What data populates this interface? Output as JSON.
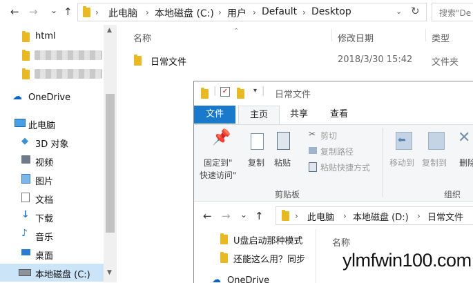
{
  "outer": {
    "nav": {
      "back": "←",
      "forward": "→",
      "recent": "⌄",
      "up": "↑"
    },
    "breadcrumb": [
      "此电脑",
      "本地磁盘 (C:)",
      "用户",
      "Default",
      "Desktop"
    ],
    "search_placeholder": "搜索\"De",
    "columns": {
      "name": "名称",
      "date": "修改日期",
      "type": "类型"
    },
    "file": {
      "name": "日常文件",
      "date": "2018/3/30 15:42",
      "type": "文件夹"
    },
    "sidebar": {
      "html": "html",
      "onedrive": "OneDrive",
      "thispc": "此电脑",
      "objects": "3D 对象",
      "video": "视频",
      "pictures": "图片",
      "docs": "文档",
      "downloads": "下载",
      "music": "音乐",
      "desktop": "桌面",
      "cdrive": "本地磁盘 (C:)"
    }
  },
  "inner": {
    "title": "日常文件",
    "tabs": {
      "file": "文件",
      "home": "主页",
      "share": "共享",
      "view": "查看"
    },
    "ribbon": {
      "pin_line1": "固定到\"",
      "pin_line2": "快速访问\"",
      "copy": "复制",
      "paste": "粘贴",
      "cut": "剪切",
      "copy_path": "复制路径",
      "paste_shortcut": "粘贴快捷方式",
      "clipboard": "剪贴板",
      "move_to": "移动到",
      "copy_to": "复制到",
      "delete": "删除",
      "organize": "组织"
    },
    "nav": {
      "back": "←",
      "forward": "→",
      "recent": "⌄",
      "up": "↑"
    },
    "breadcrumb": [
      "此电脑",
      "本地磁盘 (D:)",
      "日常文件"
    ],
    "tree": {
      "item1": "U盘启动那种模式",
      "item2": "还能这么用？同步",
      "onedrive": "OneDrive"
    },
    "column_name": "名称"
  },
  "watermark": "ylmfwin100.com"
}
